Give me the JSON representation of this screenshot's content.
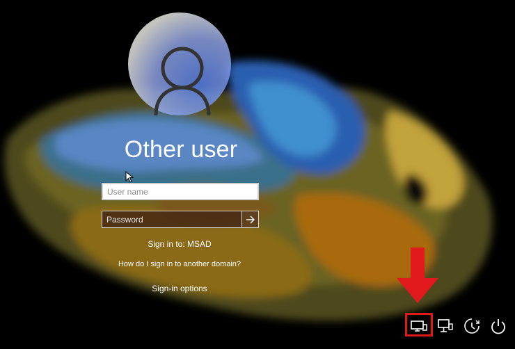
{
  "user": {
    "display_name": "Other user"
  },
  "login_form": {
    "username_placeholder": "User name",
    "password_placeholder": "Password"
  },
  "domain_info": {
    "sign_in_to": "Sign in to: MSAD",
    "other_domain_link": "How do I sign in to another domain?"
  },
  "sign_in_options": "Sign-in options",
  "tray_icons": [
    "monitor-icon",
    "network-icon",
    "ease-of-access-icon",
    "power-icon"
  ],
  "colors": {
    "highlight": "#e2191c",
    "arrow": "#e2191c",
    "text": "#ffffff"
  }
}
